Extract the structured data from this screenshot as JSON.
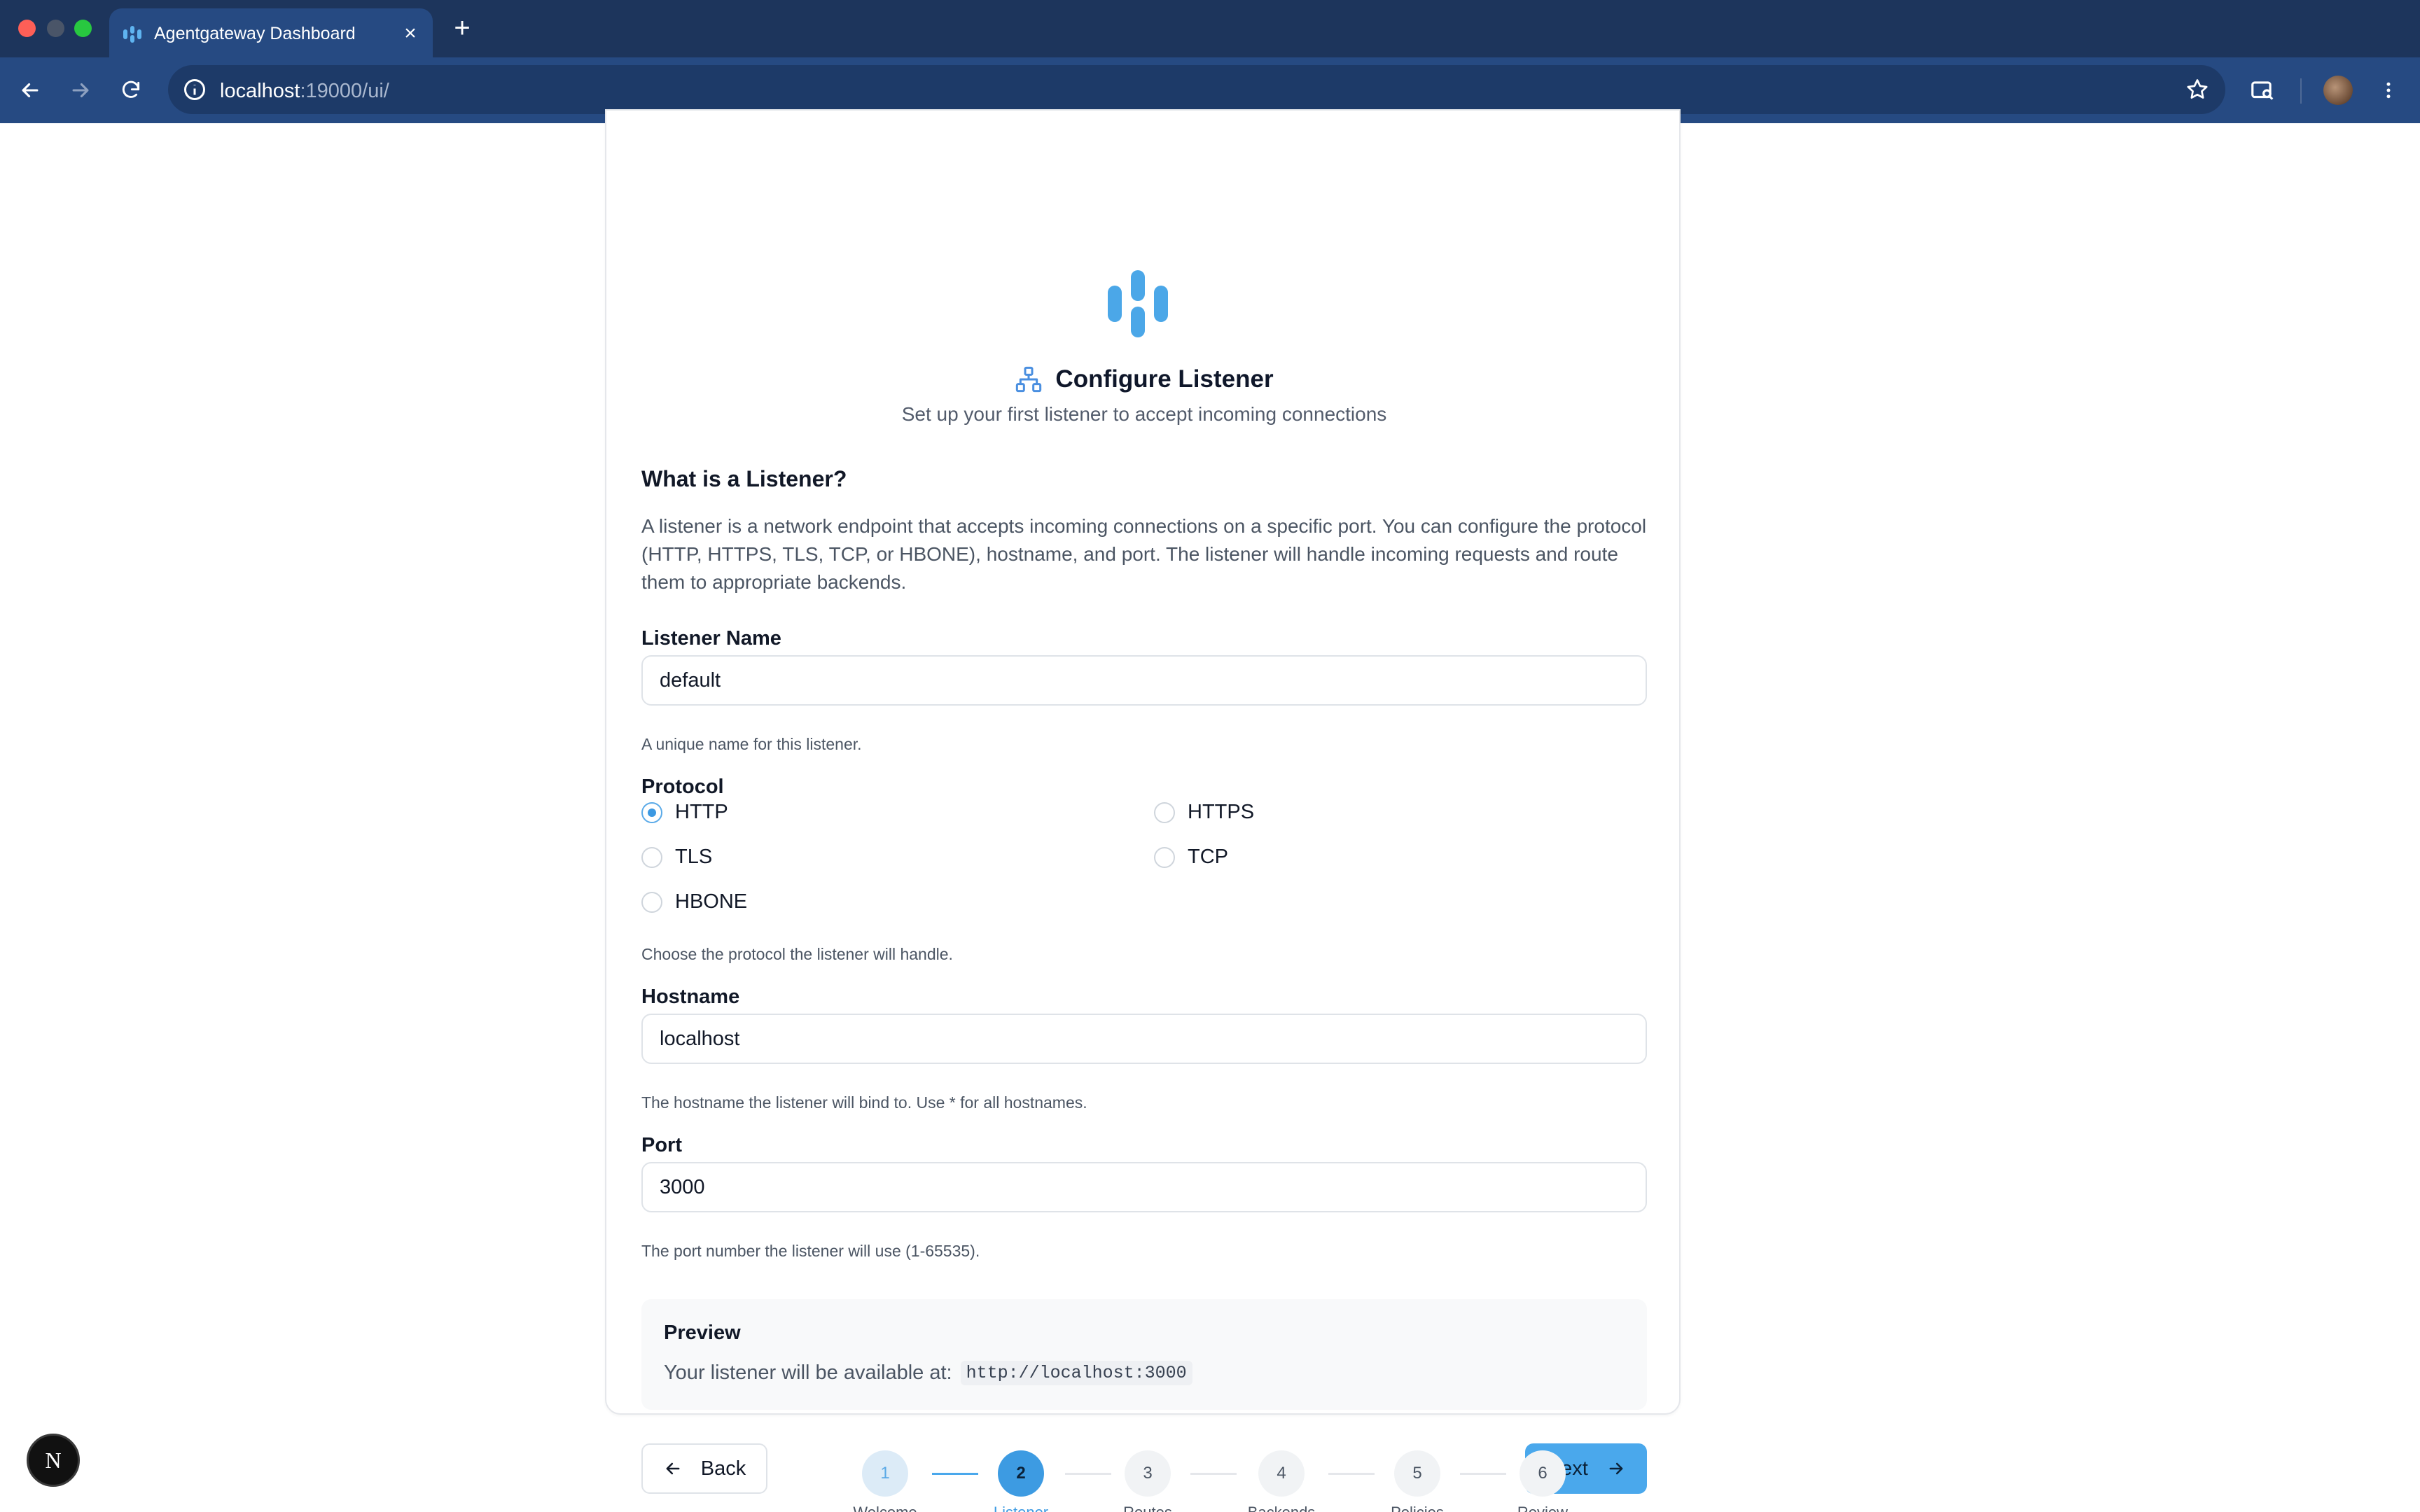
{
  "browser": {
    "tab_title": "Agentgateway Dashboard",
    "url_host": "localhost",
    "url_rest": ":19000/ui/"
  },
  "header": {
    "title": "Configure Listener",
    "subtitle": "Set up your first listener to accept incoming connections"
  },
  "intro": {
    "title": "What is a Listener?",
    "body": "A listener is a network endpoint that accepts incoming connections on a specific port. You can configure the protocol (HTTP, HTTPS, TLS, TCP, or HBONE), hostname, and port. The listener will handle incoming requests and route them to appropriate backends."
  },
  "form": {
    "name": {
      "label": "Listener Name",
      "value": "default",
      "help": "A unique name for this listener."
    },
    "protocol": {
      "label": "Protocol",
      "options": [
        "HTTP",
        "HTTPS",
        "TLS",
        "TCP",
        "HBONE"
      ],
      "selected": "HTTP",
      "help": "Choose the protocol the listener will handle."
    },
    "hostname": {
      "label": "Hostname",
      "value": "localhost",
      "help": "The hostname the listener will bind to. Use * for all hostnames."
    },
    "port": {
      "label": "Port",
      "value": "3000",
      "help": "The port number the listener will use (1-65535)."
    }
  },
  "preview": {
    "title": "Preview",
    "text": "Your listener will be available at:",
    "url": "http://localhost:3000"
  },
  "buttons": {
    "back": "Back",
    "next": "Next"
  },
  "stepper": {
    "current": 2,
    "steps": [
      {
        "number": "1",
        "label": "Welcome"
      },
      {
        "number": "2",
        "label": "Listener"
      },
      {
        "number": "3",
        "label": "Routes"
      },
      {
        "number": "4",
        "label": "Backends"
      },
      {
        "number": "5",
        "label": "Policies"
      },
      {
        "number": "6",
        "label": "Review"
      }
    ]
  },
  "dev_badge": "N",
  "colors": {
    "accent": "#4aa8ec",
    "chrome_dark": "#1d355c",
    "chrome_toolbar": "#264a82"
  }
}
